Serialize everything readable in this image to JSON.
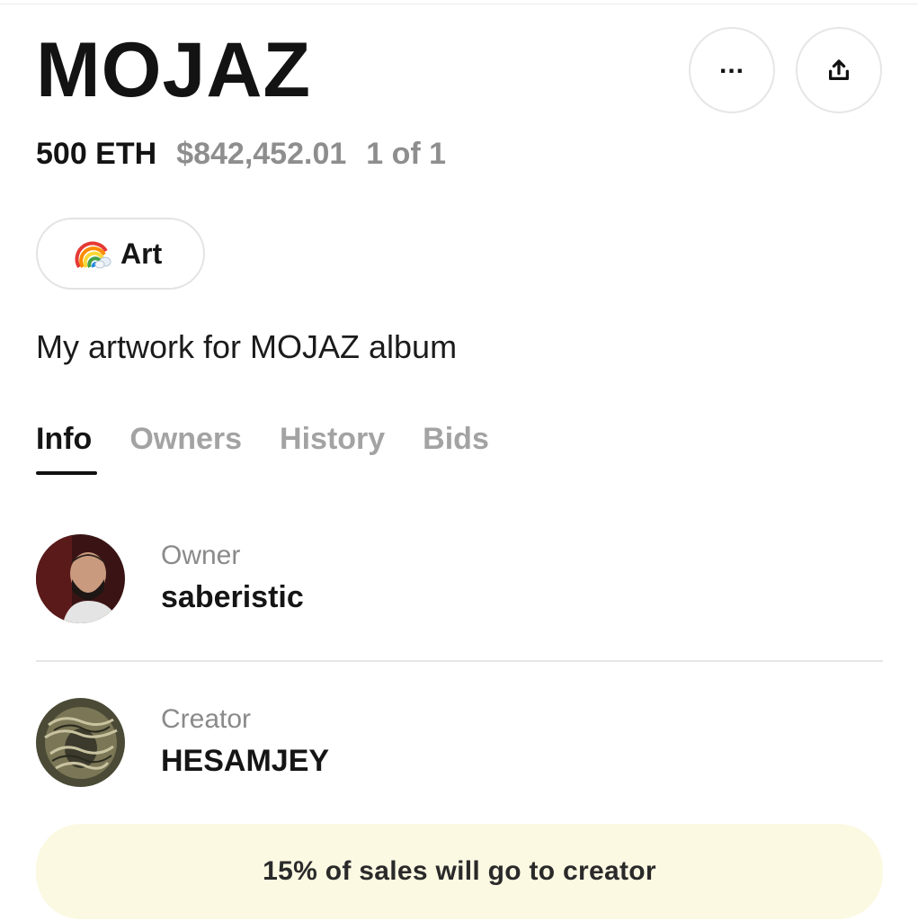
{
  "nft": {
    "title": "MOJAZ",
    "price_eth": "500 ETH",
    "price_usd": "$842,452.01",
    "edition": "1 of 1",
    "tag": {
      "icon": "rainbow-icon",
      "label": "Art"
    },
    "description": "My artwork for MOJAZ album"
  },
  "actions": {
    "more": {
      "icon": "more-dots-icon",
      "glyph": "..."
    },
    "share": {
      "icon": "share-upload-icon"
    }
  },
  "tabs": [
    {
      "label": "Info",
      "active": true
    },
    {
      "label": "Owners",
      "active": false
    },
    {
      "label": "History",
      "active": false
    },
    {
      "label": "Bids",
      "active": false
    }
  ],
  "owner": {
    "role": "Owner",
    "name": "saberistic",
    "avatar": "owner-avatar-photo"
  },
  "creator": {
    "role": "Creator",
    "name": "HESAMJEY",
    "avatar": "creator-avatar-artwork"
  },
  "royalty": {
    "text": "15% of sales will go to creator"
  },
  "colors": {
    "primary_text": "#131313",
    "muted_text": "#8e8e8e",
    "inactive_tab": "#a3a3a3",
    "royalty_bg": "#fcf9e3",
    "border": "#e6e6e6"
  }
}
